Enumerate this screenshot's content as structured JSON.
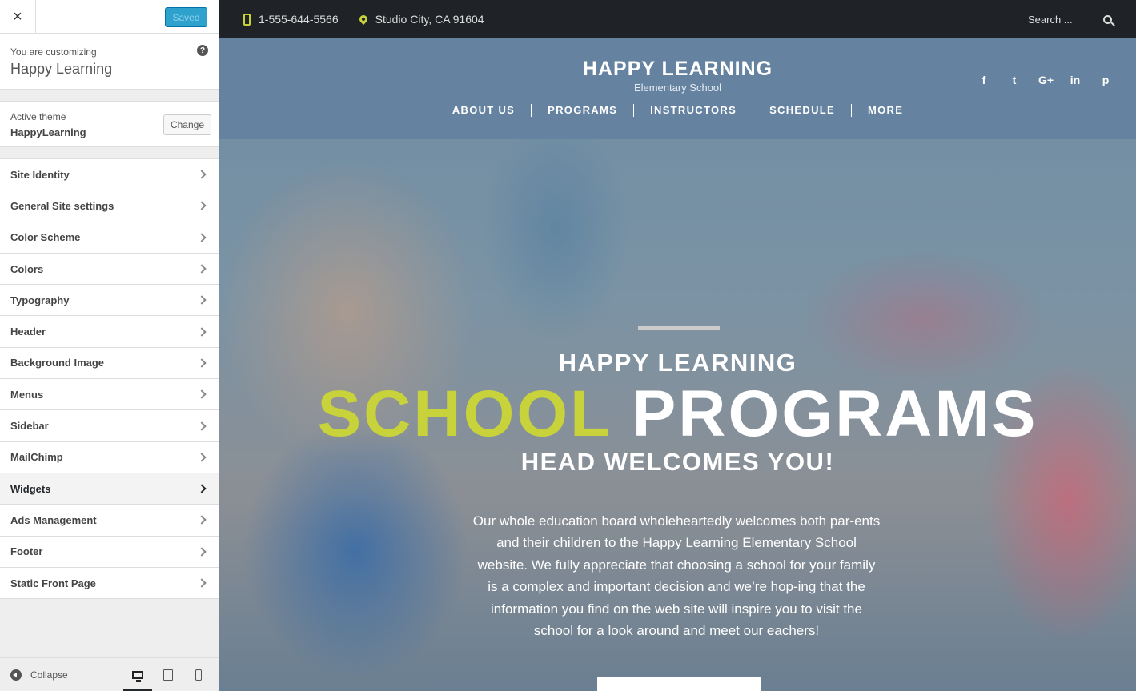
{
  "customizer": {
    "close_label": "×",
    "saved_label": "Saved",
    "customizing_label": "You are customizing",
    "site_name": "Happy Learning",
    "help_label": "?",
    "active_theme_label": "Active theme",
    "theme_name": "HappyLearning",
    "change_label": "Change",
    "sections": [
      {
        "label": "Site Identity"
      },
      {
        "label": "General Site settings"
      },
      {
        "label": "Color Scheme"
      },
      {
        "label": "Colors"
      },
      {
        "label": "Typography"
      },
      {
        "label": "Header"
      },
      {
        "label": "Background Image"
      },
      {
        "label": "Menus"
      },
      {
        "label": "Sidebar"
      },
      {
        "label": "MailChimp"
      },
      {
        "label": "Widgets"
      },
      {
        "label": "Ads Management"
      },
      {
        "label": "Footer"
      },
      {
        "label": "Static Front Page"
      }
    ],
    "active_section": "Widgets",
    "collapse_label": "Collapse",
    "devices": [
      "desktop",
      "tablet",
      "mobile"
    ],
    "active_device": "desktop"
  },
  "site": {
    "topbar": {
      "phone": "1-555-644-5566",
      "address": "Studio City, CA 91604",
      "search_placeholder": "Search ..."
    },
    "title": "HAPPY LEARNING",
    "tagline": "Elementary School",
    "nav": [
      "ABOUT US",
      "PROGRAMS",
      "INSTRUCTORS",
      "SCHEDULE",
      "MORE"
    ],
    "social_icons": [
      "facebook-icon",
      "twitter-icon",
      "google-plus-icon",
      "linkedin-icon",
      "pinterest-icon"
    ],
    "social_glyphs": [
      "f",
      "t",
      "G+",
      "in",
      "p"
    ],
    "hero": {
      "kicker": "HAPPY LEARNING",
      "title_accent": "SCHOOL",
      "title_rest": "PROGRAMS",
      "subtitle": "HEAD WELCOMES YOU!",
      "body": "Our whole education board wholeheartedly welcomes both par-ents and their children to the Happy Learning Elementary School website. We fully appreciate that choosing a school for your family is a complex and important decision and we’re hop-ing that the information you find on the web site will inspire you to visit the school for a look around and meet our eachers!"
    }
  },
  "colors": {
    "accent": "#c8d23a",
    "topbar_bg": "#1f2226",
    "nav_bg": "#6482a0",
    "wp_blue": "#2ea2cc"
  }
}
